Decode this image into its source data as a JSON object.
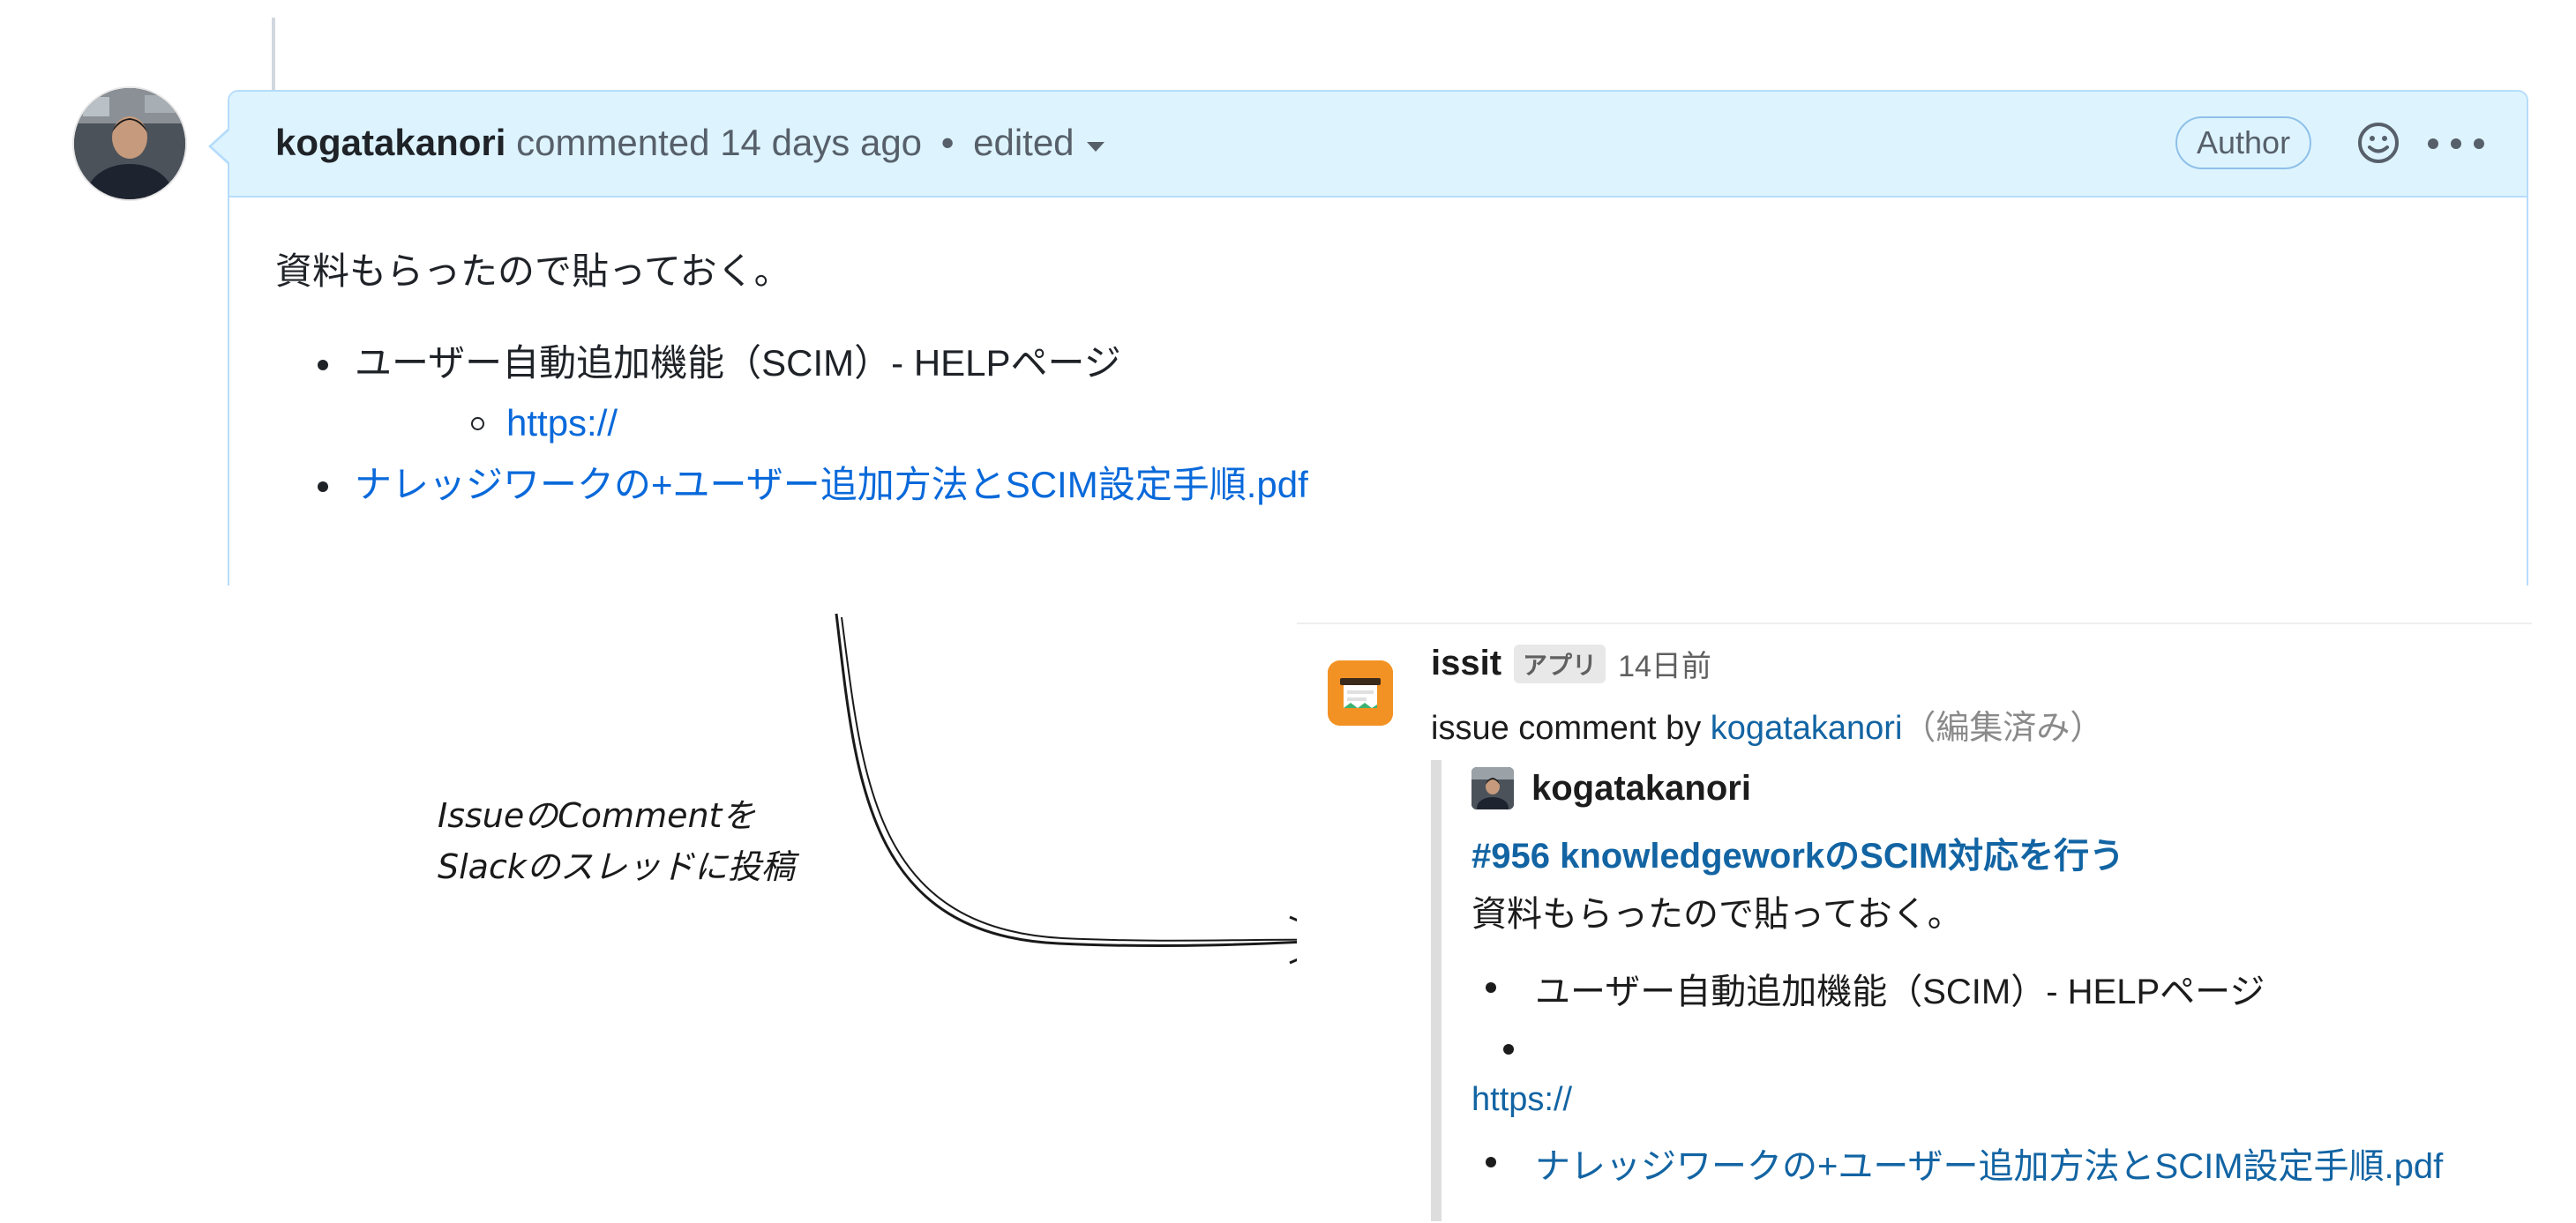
{
  "github": {
    "author": "kogatakanori",
    "action": "commented 14 days ago",
    "separator": "•",
    "edited": "edited",
    "badge": "Author",
    "body_text": "資料もらったので貼っておく。",
    "items": [
      {
        "text": "ユーザー自動追加機能（SCIM）- HELPページ",
        "sub_link": "https://"
      },
      {
        "link": "ナレッジワークの+ユーザー追加方法とSCIM設定手順.pdf"
      }
    ]
  },
  "annotation": {
    "line1": "IssueのCommentを",
    "line2": "Slackのスレッドに投稿"
  },
  "slack": {
    "app_name": "issit",
    "app_tag": "アプリ",
    "time": "14日前",
    "line_prefix": "issue comment by ",
    "line_user": "kogatakanori",
    "line_suffix": "（編集済み）",
    "attachment": {
      "author": "kogatakanori",
      "title": "#956 knowledgeworkのSCIM対応を行う",
      "text": "資料もらったので貼っておく。",
      "item1": "ユーザー自動追加機能（SCIM）- HELPページ",
      "link": "https://",
      "item3": "ナレッジワークの+ユーザー追加方法とSCIM設定手順.pdf"
    }
  },
  "colors": {
    "github_header_bg": "#ddf4ff",
    "github_border": "#b6dcfb",
    "github_link": "#0969da",
    "slack_link": "#1264a3",
    "app_icon_bg": "#f29224"
  },
  "icons": [
    "user-avatar-photo",
    "caret-down-icon",
    "smiley-icon",
    "kebab-icon",
    "issit-app-icon",
    "mini-avatar-photo",
    "hand-drawn-arrow"
  ]
}
